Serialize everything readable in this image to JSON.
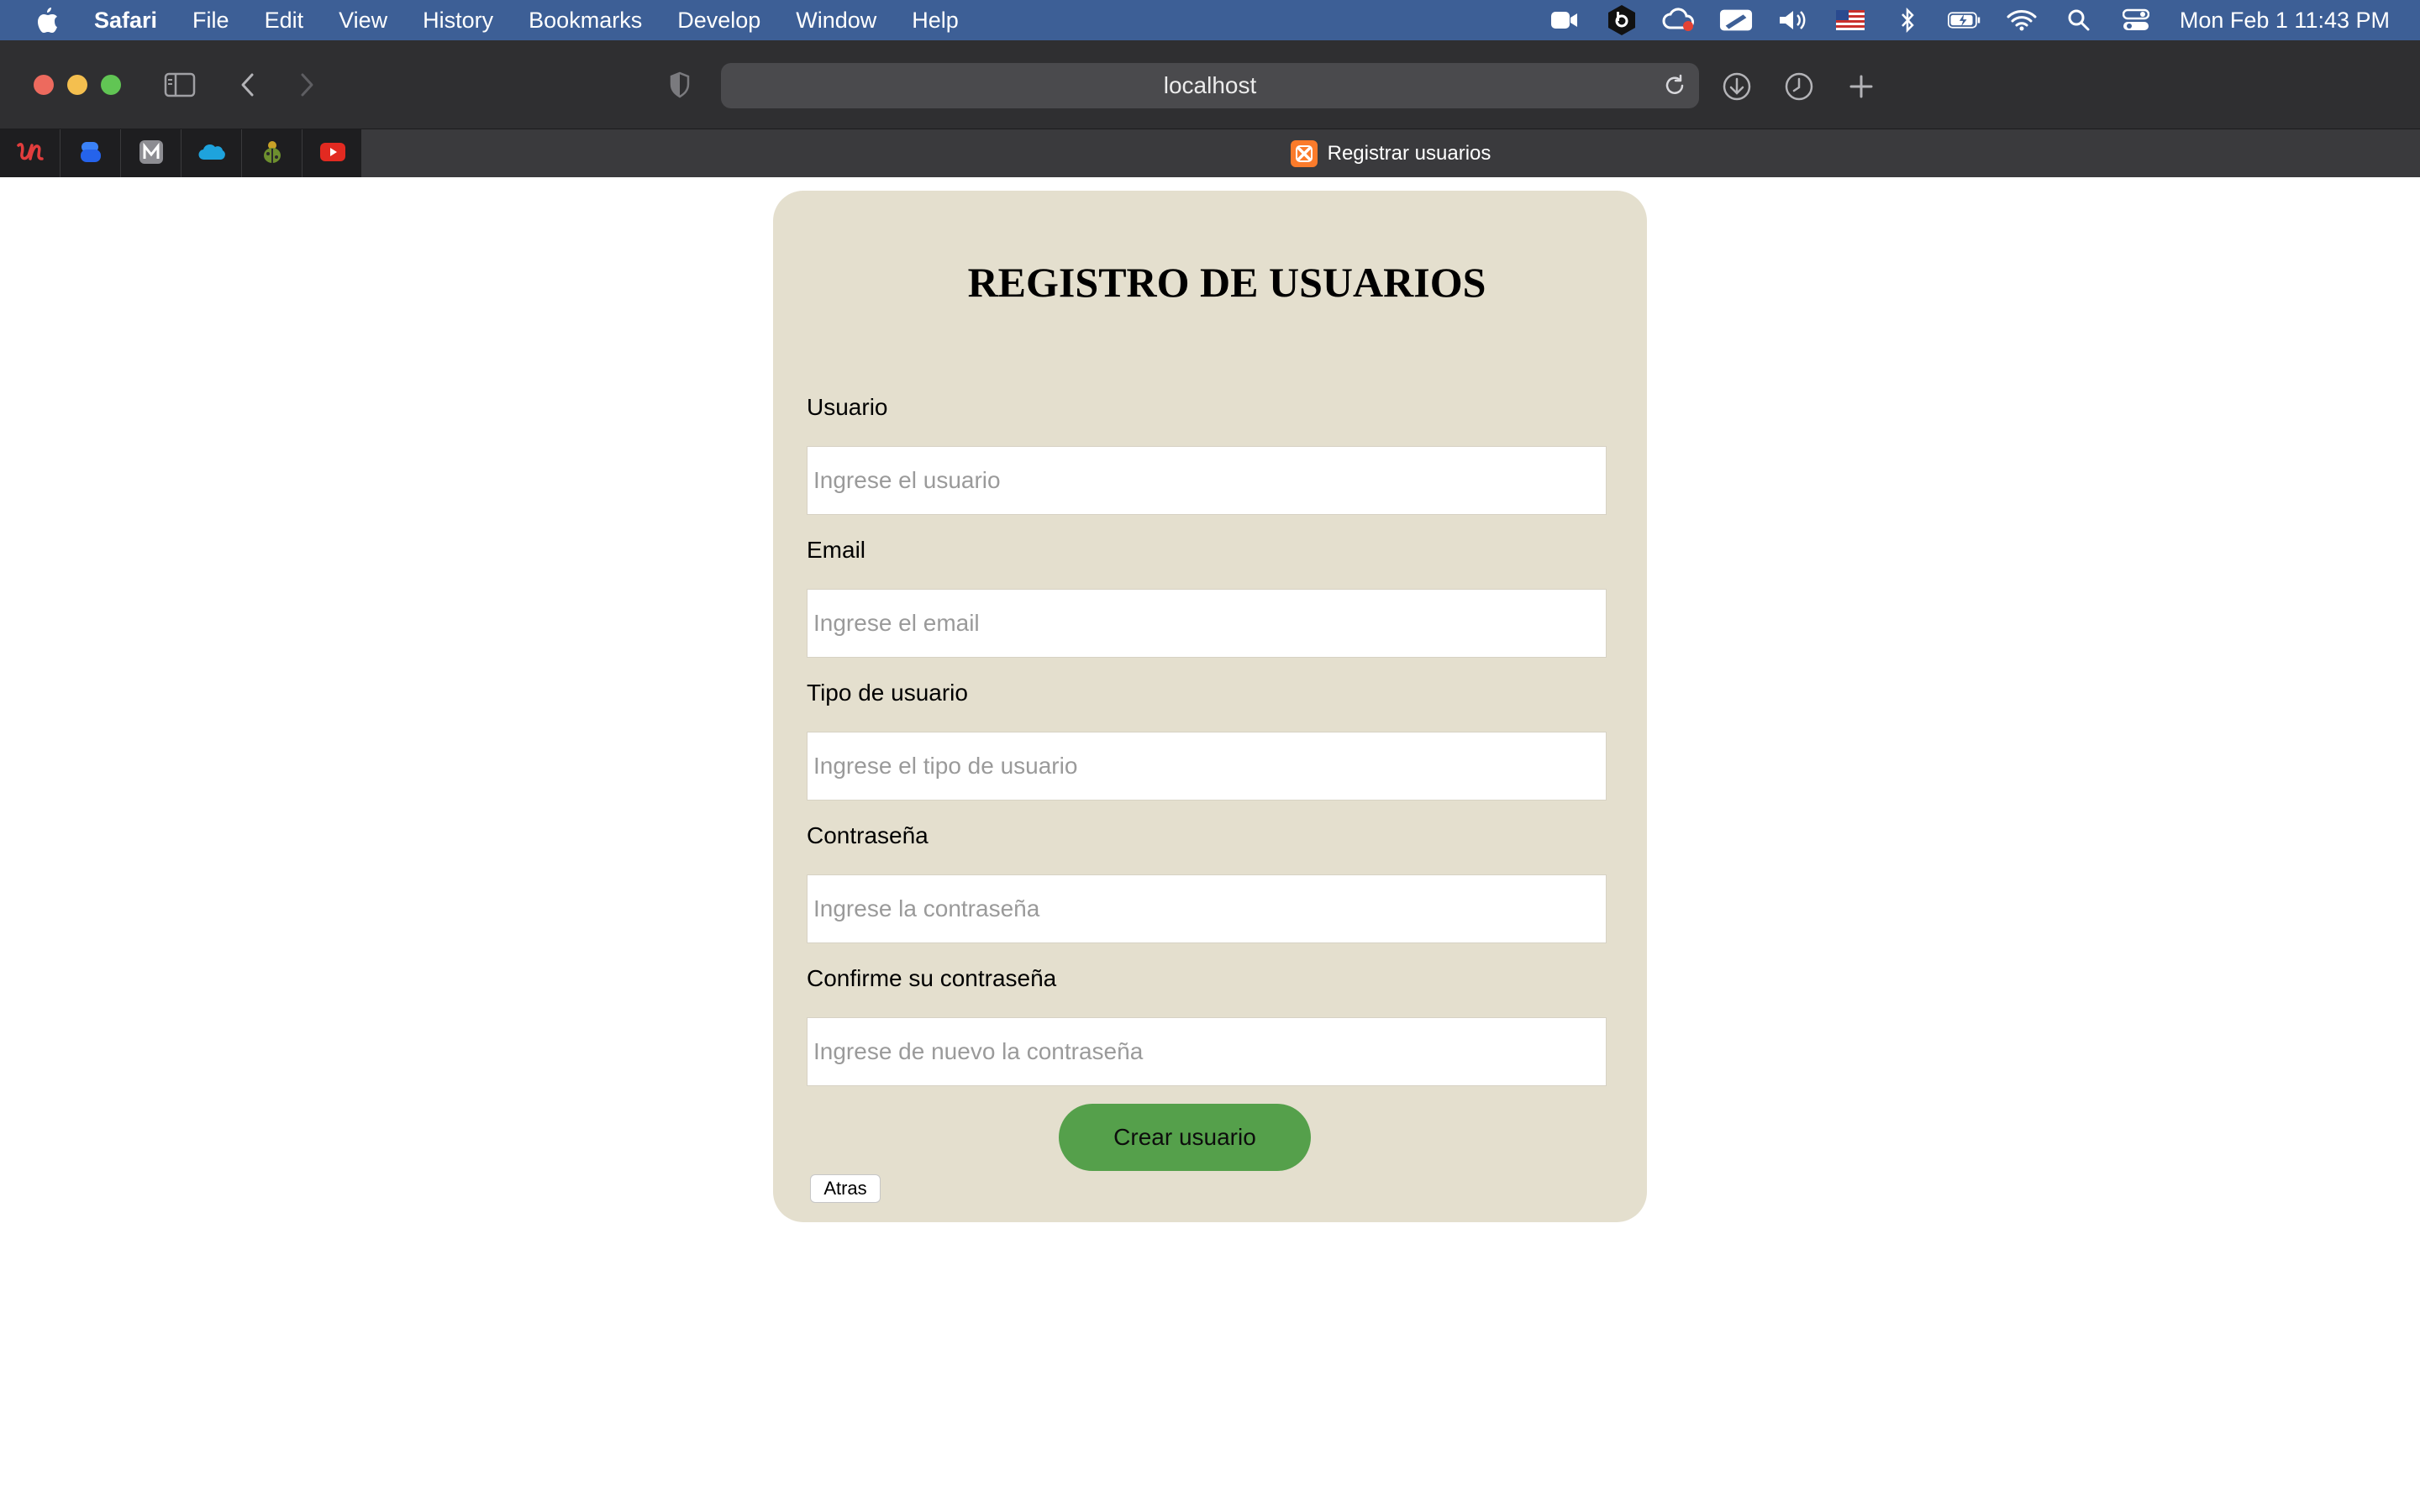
{
  "menubar": {
    "app_name": "Safari",
    "items": [
      "File",
      "Edit",
      "View",
      "History",
      "Bookmarks",
      "Develop",
      "Window",
      "Help"
    ],
    "clock": "Mon Feb 1  11:43 PM"
  },
  "browser": {
    "address": "localhost",
    "active_tab_title": "Registrar usuarios"
  },
  "form": {
    "title": "REGISTRO DE USUARIOS",
    "fields": [
      {
        "label": "Usuario",
        "placeholder": "Ingrese el usuario"
      },
      {
        "label": "Email",
        "placeholder": "Ingrese el email"
      },
      {
        "label": "Tipo de usuario",
        "placeholder": "Ingrese el tipo de usuario"
      },
      {
        "label": "Contraseña",
        "placeholder": "Ingrese la contraseña"
      },
      {
        "label": "Confirme su contraseña",
        "placeholder": "Ingrese de nuevo la contraseña"
      }
    ],
    "submit_label": "Crear usuario",
    "back_label": "Atras"
  },
  "colors": {
    "menubar_bg": "#3d5f96",
    "card_bg": "#e4dfce",
    "submit_bg": "#55a04b"
  },
  "icons": {
    "menubar_status": [
      "zoom-icon",
      "b-app-icon",
      "creative-cloud-icon",
      "pen-icon",
      "volume-icon",
      "us-flag-icon",
      "bluetooth-icon",
      "battery-icon",
      "wifi-icon",
      "spotlight-icon",
      "control-center-icon"
    ],
    "favorites": [
      "u-app-icon",
      "blue-app-icon",
      "m-app-icon",
      "salesforce-icon",
      "ladybug-icon",
      "youtube-icon"
    ]
  }
}
